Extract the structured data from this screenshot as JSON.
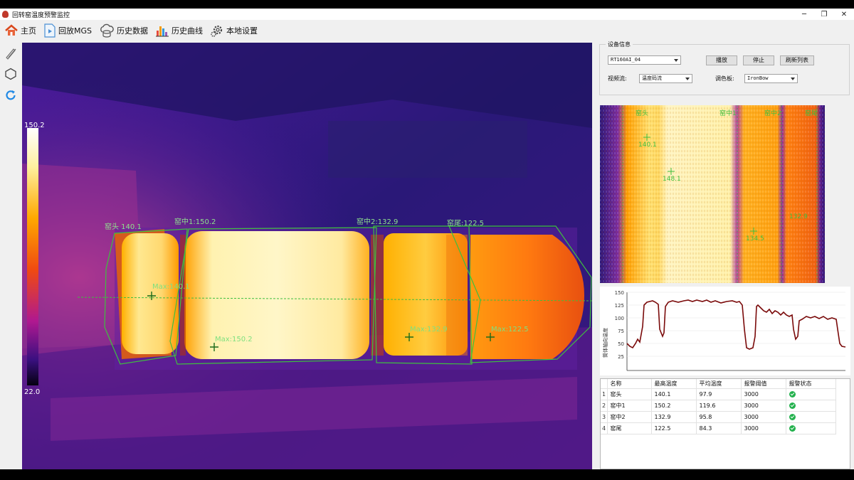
{
  "window": {
    "title": "回转窑温度预警监控",
    "minimize": "─",
    "maximize": "❐",
    "close": "✕"
  },
  "toolbar": {
    "items": [
      {
        "icon": "home-icon",
        "label": "主页"
      },
      {
        "icon": "play-file-icon",
        "label": "回放MGS"
      },
      {
        "icon": "cloud-database-icon",
        "label": "历史数据"
      },
      {
        "icon": "bar-chart-icon",
        "label": "历史曲线"
      },
      {
        "icon": "gear-icon",
        "label": "本地设置"
      }
    ]
  },
  "left_tools": [
    {
      "icon": "ruler-pencil-icon"
    },
    {
      "icon": "hexagon-icon"
    },
    {
      "icon": "refresh-icon"
    }
  ],
  "thermal": {
    "scale_max": "150.2",
    "scale_min": "22.0",
    "zones": [
      {
        "label": "窑头 140.1",
        "max_label": "Max:140.1"
      },
      {
        "label": "窑中1:150.2",
        "max_label": "Max:150.2"
      },
      {
        "label": "窑中2:132.9",
        "max_label": "Max:132.9"
      },
      {
        "label": "窑尾:122.5",
        "max_label": "Max:122.5"
      }
    ]
  },
  "device": {
    "group_title": "设备信息",
    "device_select": "RT160AI_04",
    "play_button": "播放",
    "stop_button": "停止",
    "refresh_button": "刷新列表",
    "stream_label": "视频流:",
    "stream_select": "温度码流",
    "palette_label": "调色板:",
    "palette_select": "IronBow"
  },
  "kymograph": {
    "zone_labels": [
      "窑头",
      "窑中1",
      "窑中2",
      "窑尾"
    ],
    "points": [
      "140.1",
      "148.1",
      "132.9",
      "134.5"
    ]
  },
  "profile_chart": {
    "ylabel": "筒体轴向温度",
    "yticks": [
      "150",
      "125",
      "100",
      "75",
      "50",
      "25"
    ]
  },
  "table": {
    "headers": [
      "名称",
      "最高温度",
      "平均温度",
      "报警阈值",
      "报警状态"
    ],
    "rows": [
      {
        "num": "1",
        "name": "窑头",
        "max": "140.1",
        "avg": "97.9",
        "threshold": "3000"
      },
      {
        "num": "2",
        "name": "窑中1",
        "max": "150.2",
        "avg": "119.6",
        "threshold": "3000"
      },
      {
        "num": "3",
        "name": "窑中2",
        "max": "132.9",
        "avg": "95.8",
        "threshold": "3000"
      },
      {
        "num": "4",
        "name": "窑尾",
        "max": "122.5",
        "avg": "84.3",
        "threshold": "3000"
      }
    ]
  },
  "colors": {
    "roi_outline": "#3fbf3f",
    "hot": "#fff7c0",
    "warm": "#ffb000",
    "mid": "#f05000",
    "cool": "#9020a0",
    "cold": "#2a1870",
    "line": "#7a0a0a",
    "ok": "#23b14d"
  }
}
